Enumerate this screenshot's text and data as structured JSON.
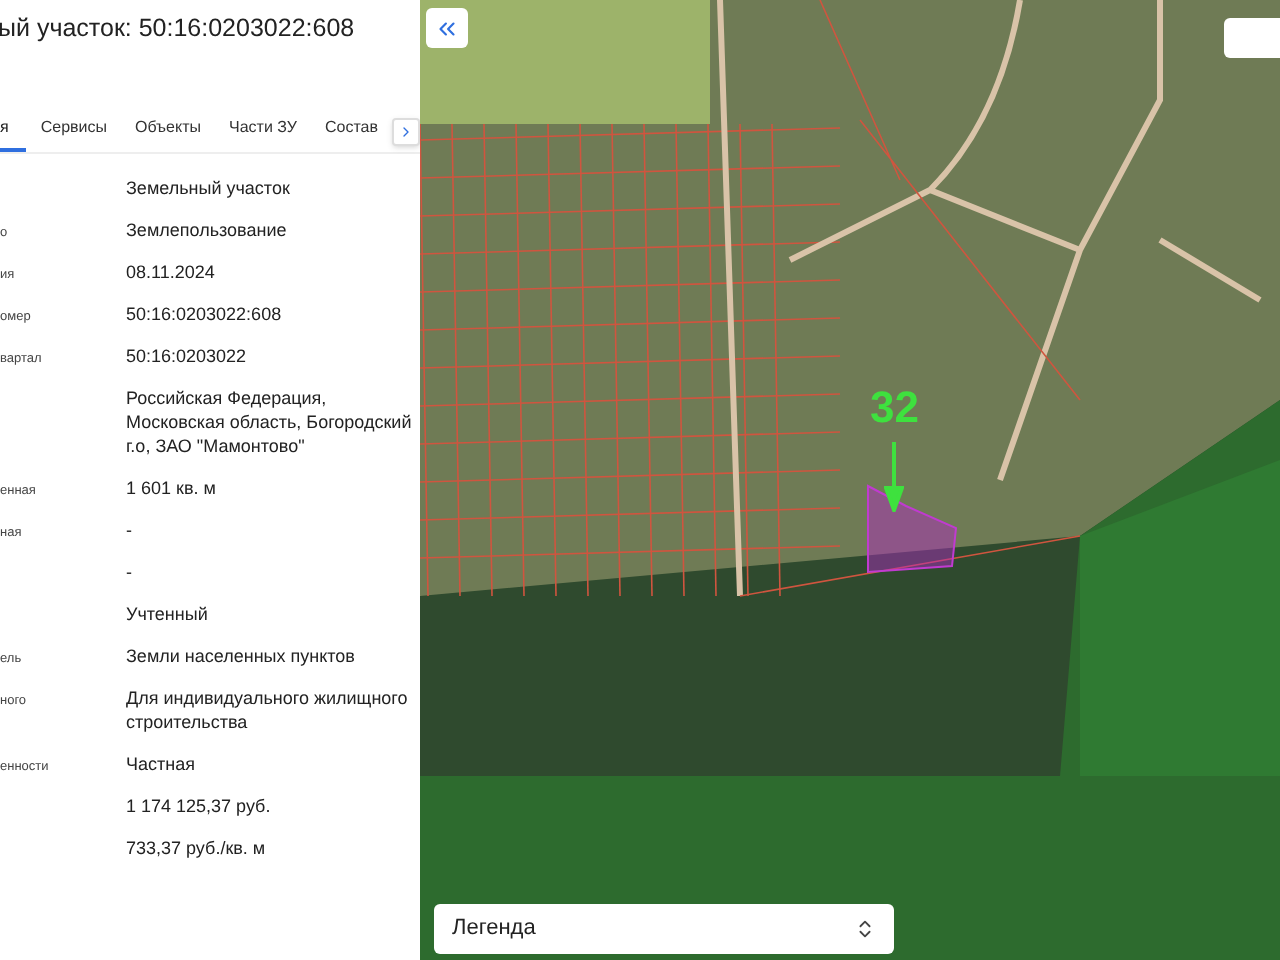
{
  "panel": {
    "title": "ый участок: 50:16:0203022:608",
    "tabs": [
      {
        "label": "я",
        "selected": true
      },
      {
        "label": "Сервисы",
        "selected": false
      },
      {
        "label": "Объекты",
        "selected": false
      },
      {
        "label": "Части ЗУ",
        "selected": false
      },
      {
        "label": "Состав",
        "selected": false
      }
    ],
    "rows": [
      {
        "value": "Земельный участок"
      },
      {
        "label": "о",
        "value": "Землепользование"
      },
      {
        "label": "ия",
        "value": "08.11.2024"
      },
      {
        "label": "омер",
        "value": "50:16:0203022:608"
      },
      {
        "label": "вартал",
        "value": "50:16:0203022"
      },
      {
        "value": "Российская Федерация, Московская область, Богородский г.о, ЗАО \"Мамонтово\""
      },
      {
        "label": "енная",
        "value": "1 601 кв. м"
      },
      {
        "label": "ная",
        "value": "-"
      },
      {
        "value": "-"
      },
      {
        "value": "Учтенный"
      },
      {
        "label": "ель",
        "value": "Земли населенных пунктов"
      },
      {
        "label": "ного",
        "value": "Для индивидуального жилищного строительства"
      },
      {
        "label": "енности",
        "value": "Частная"
      },
      {
        "value": "1 174 125,37 руб."
      },
      {
        "value": "733,37 руб./кв. м"
      }
    ]
  },
  "map": {
    "marker_label": "32",
    "legend": {
      "value": "Легенда"
    }
  }
}
